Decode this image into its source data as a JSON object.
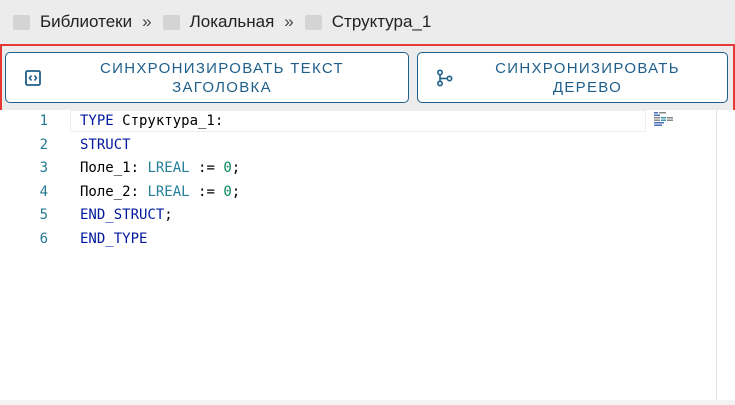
{
  "breadcrumb": {
    "items": [
      {
        "label": "Библиотеки",
        "icon": "folder-icon"
      },
      {
        "label": "Локальная",
        "icon": "folder-icon"
      },
      {
        "label": "Структура_1",
        "icon": "folder-icon"
      }
    ],
    "separator": "»"
  },
  "toolbar": {
    "sync_text_line1": "СИНХРОНИЗИРОВАТЬ ТЕКСТ",
    "sync_text_line2": "ЗАГОЛОВКА",
    "sync_tree_line1": "СИНХРОНИЗИРОВАТЬ",
    "sync_tree_line2": "ДЕРЕВО",
    "sync_text_icon": "code-brackets-icon",
    "sync_tree_icon": "tree-icon",
    "accent_color": "#1f5f8b",
    "highlight_color": "#e53935"
  },
  "editor": {
    "line_numbers": [
      "1",
      "2",
      "3",
      "4",
      "5",
      "6"
    ],
    "lines": [
      [
        {
          "t": "TYPE",
          "c": "kw"
        },
        {
          "t": " Структура_1:",
          "c": ""
        }
      ],
      [
        {
          "t": "STRUCT",
          "c": "kw"
        }
      ],
      [
        {
          "t": "Поле_1: ",
          "c": ""
        },
        {
          "t": "LREAL",
          "c": "ty"
        },
        {
          "t": " := ",
          "c": ""
        },
        {
          "t": "0",
          "c": "num"
        },
        {
          "t": ";",
          "c": ""
        }
      ],
      [
        {
          "t": "Поле_2: ",
          "c": ""
        },
        {
          "t": "LREAL",
          "c": "ty"
        },
        {
          "t": " := ",
          "c": ""
        },
        {
          "t": "0",
          "c": "num"
        },
        {
          "t": ";",
          "c": ""
        }
      ],
      [
        {
          "t": "END_STRUCT",
          "c": "kw"
        },
        {
          "t": ";",
          "c": ""
        }
      ],
      [
        {
          "t": "END_TYPE",
          "c": "kw"
        }
      ]
    ]
  }
}
